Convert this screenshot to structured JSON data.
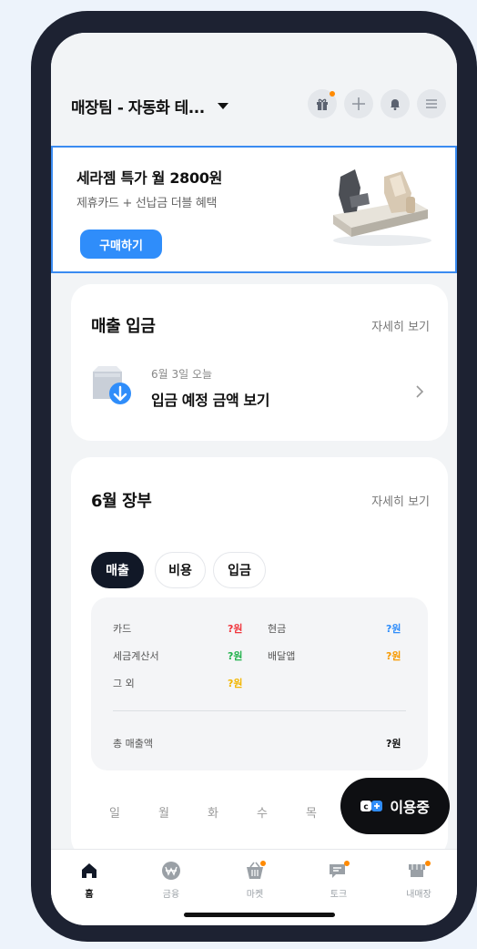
{
  "header": {
    "store_name": "매장팀 - 자동화 테...",
    "icons": [
      "gift-icon",
      "plus-icon",
      "bell-icon",
      "menu-icon"
    ]
  },
  "banner": {
    "title": "세라젬 특가 월 2800원",
    "subtitle": "제휴카드 + 선납금 더블 혜택",
    "button": "구매하기"
  },
  "deposit_card": {
    "title": "매출 입금",
    "detail_link": "자세히 보기",
    "date": "6월 3일 오늘",
    "action": "입금 예정 금액 보기"
  },
  "ledger_card": {
    "title": "6월 장부",
    "detail_link": "자세히 보기",
    "tabs": [
      "매출",
      "비용",
      "입금"
    ],
    "active_tab": "매출",
    "rows": [
      {
        "label": "카드",
        "value": "?원",
        "color": "#f0363d"
      },
      {
        "label": "현금",
        "value": "?원",
        "color": "#2f8dfa"
      },
      {
        "label": "세금계산서",
        "value": "?원",
        "color": "#22b24c"
      },
      {
        "label": "배달앱",
        "value": "?원",
        "color": "#f79a00"
      },
      {
        "label": "그 외",
        "value": "?원",
        "color": "#f2b600"
      }
    ],
    "total_label": "총 매출액",
    "total_value": "?원",
    "weekdays": [
      "일",
      "월",
      "화",
      "수",
      "목"
    ]
  },
  "fab": {
    "label": "이용중"
  },
  "bottom_nav": {
    "items": [
      {
        "label": "홈",
        "icon": "home-icon",
        "active": true
      },
      {
        "label": "금융",
        "icon": "won-icon",
        "active": false
      },
      {
        "label": "마켓",
        "icon": "basket-icon",
        "active": false
      },
      {
        "label": "토크",
        "icon": "chat-icon",
        "active": false
      },
      {
        "label": "내매장",
        "icon": "store-icon",
        "active": false
      }
    ]
  },
  "colors": {
    "accent": "#2f8dfa",
    "badge": "#ff8a00",
    "frame": "#1d2232"
  }
}
